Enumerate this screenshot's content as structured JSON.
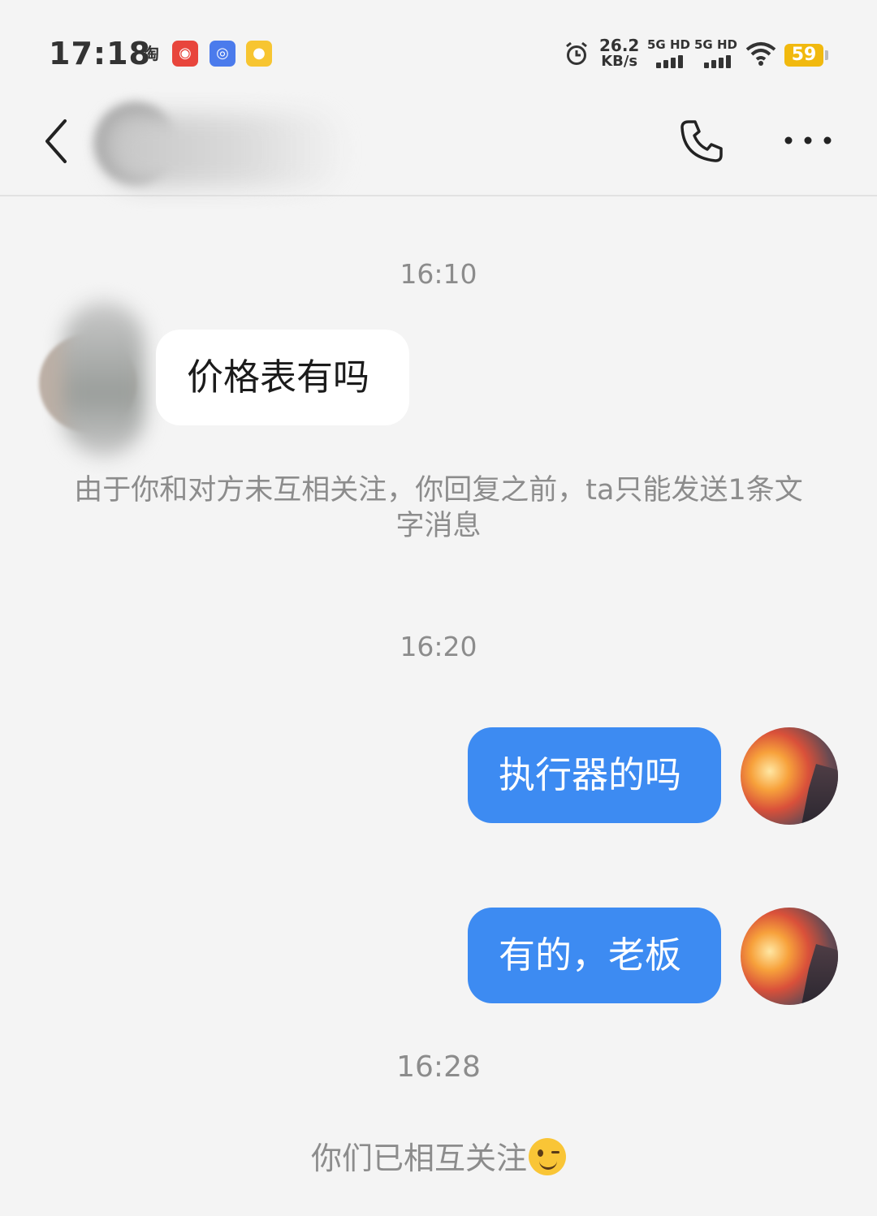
{
  "status_bar": {
    "time": "17:18",
    "apps": [
      "淘",
      "淘宝特价",
      "夸克",
      "UC"
    ],
    "net_speed": "26.2",
    "net_speed_unit": "KB/s",
    "sim1": "5G HD",
    "sim2": "5G HD",
    "battery": "59"
  },
  "header": {
    "back_icon": "chevron-left-icon",
    "call_icon": "phone-icon",
    "more_icon": "more-dots-icon"
  },
  "chat": {
    "time1": "16:10",
    "msg_in_1": "价格表有吗",
    "notice": "由于你和对方未互相关注，你回复之前，ta只能发送1条文字消息",
    "time2": "16:20",
    "msg_out_1": "执行器的吗",
    "msg_out_2": "有的，老板",
    "time3": "16:28",
    "followed_text": "你们已相互关注"
  },
  "colors": {
    "background": "#f4f4f4",
    "outgoing_bubble": "#3d8bf2",
    "incoming_bubble": "#ffffff",
    "meta_text": "#8c8c8c",
    "battery": "#f1b90e"
  }
}
